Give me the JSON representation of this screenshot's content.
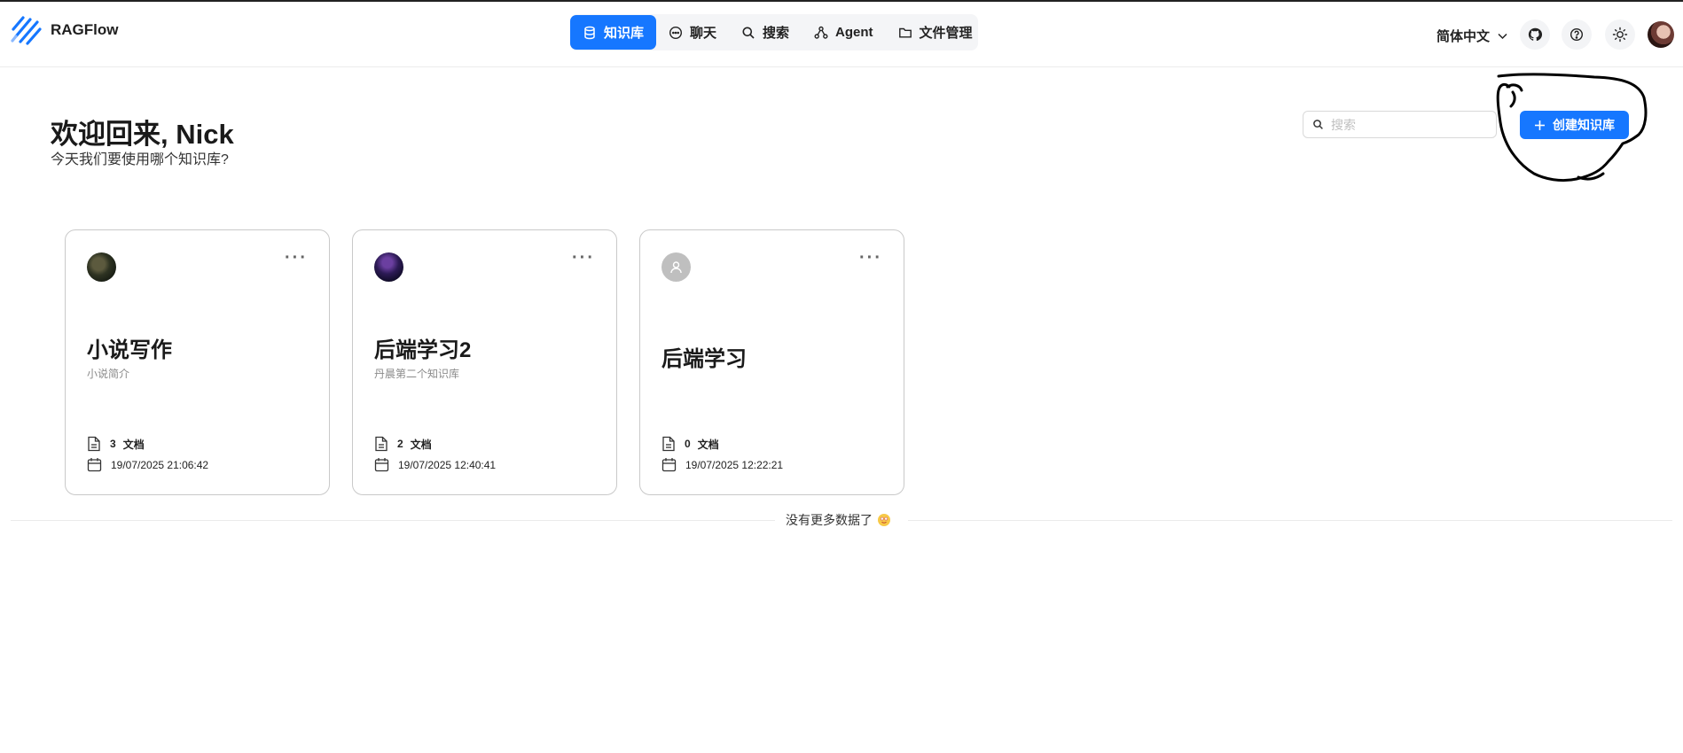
{
  "app": {
    "brand": "RAGFlow"
  },
  "nav": {
    "items": [
      {
        "label": "知识库",
        "icon": "database-icon",
        "active": true
      },
      {
        "label": "聊天",
        "icon": "chat-icon",
        "active": false
      },
      {
        "label": "搜索",
        "icon": "search-icon",
        "active": false
      },
      {
        "label": "Agent",
        "icon": "agent-icon",
        "active": false
      },
      {
        "label": "文件管理",
        "icon": "folder-icon",
        "active": false
      }
    ]
  },
  "header_right": {
    "language": "简体中文"
  },
  "main": {
    "welcome": "欢迎回来, Nick",
    "subtitle": "今天我们要使用哪个知识库?",
    "search_placeholder": "搜索",
    "create_button": "创建知识库"
  },
  "cards": [
    {
      "title": "小说写作",
      "description": "小说简介",
      "doc_count": "3",
      "doc_unit": "文档",
      "date": "19/07/2025 21:06:42"
    },
    {
      "title": "后端学习2",
      "description": "丹晨第二个知识库",
      "doc_count": "2",
      "doc_unit": "文档",
      "date": "19/07/2025 12:40:41"
    },
    {
      "title": "后端学习",
      "description": "",
      "doc_count": "0",
      "doc_unit": "文档",
      "date": "19/07/2025 12:22:21"
    }
  ],
  "footer": {
    "no_more": "没有更多数据了"
  },
  "colors": {
    "accent": "#1677ff",
    "card_border": "#c9c9c9"
  }
}
